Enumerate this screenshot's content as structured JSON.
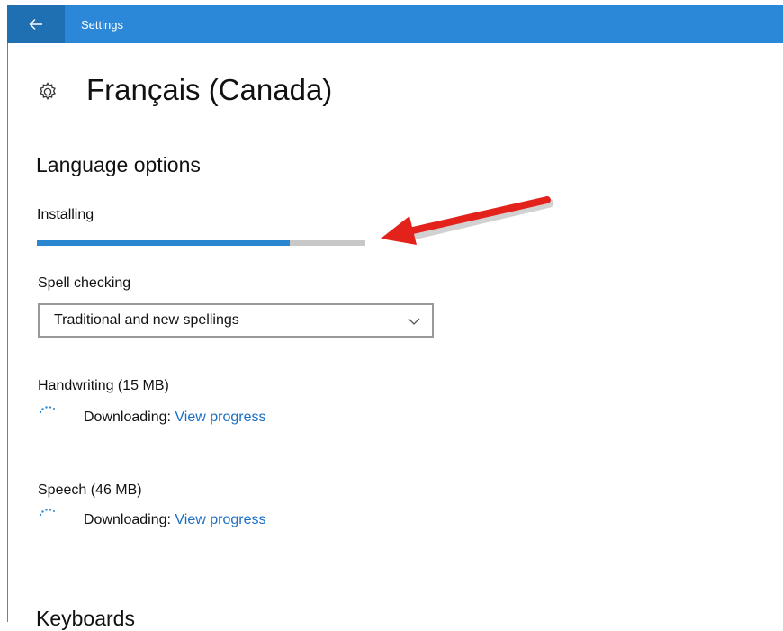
{
  "window": {
    "app_title": "Settings"
  },
  "page": {
    "title": "Français (Canada)"
  },
  "language_options": {
    "heading": "Language options",
    "install_status": "Installing",
    "install_progress_percent": 77,
    "spell_checking": {
      "label": "Spell checking",
      "selected": "Traditional and new spellings"
    },
    "handwriting": {
      "label": "Handwriting (15 MB)",
      "status": "Downloading:",
      "link": "View progress"
    },
    "speech": {
      "label": "Speech (46 MB)",
      "status": "Downloading:",
      "link": "View progress"
    }
  },
  "keyboards": {
    "heading": "Keyboards"
  },
  "icons": [
    "back-arrow-icon",
    "gear-icon",
    "chevron-down-icon",
    "spinner-icon"
  ],
  "colors": {
    "title_bar": "#2b88d8",
    "accent": "#2a86d0",
    "link": "#1a6fc4",
    "annotation_arrow": "#e3231b"
  }
}
